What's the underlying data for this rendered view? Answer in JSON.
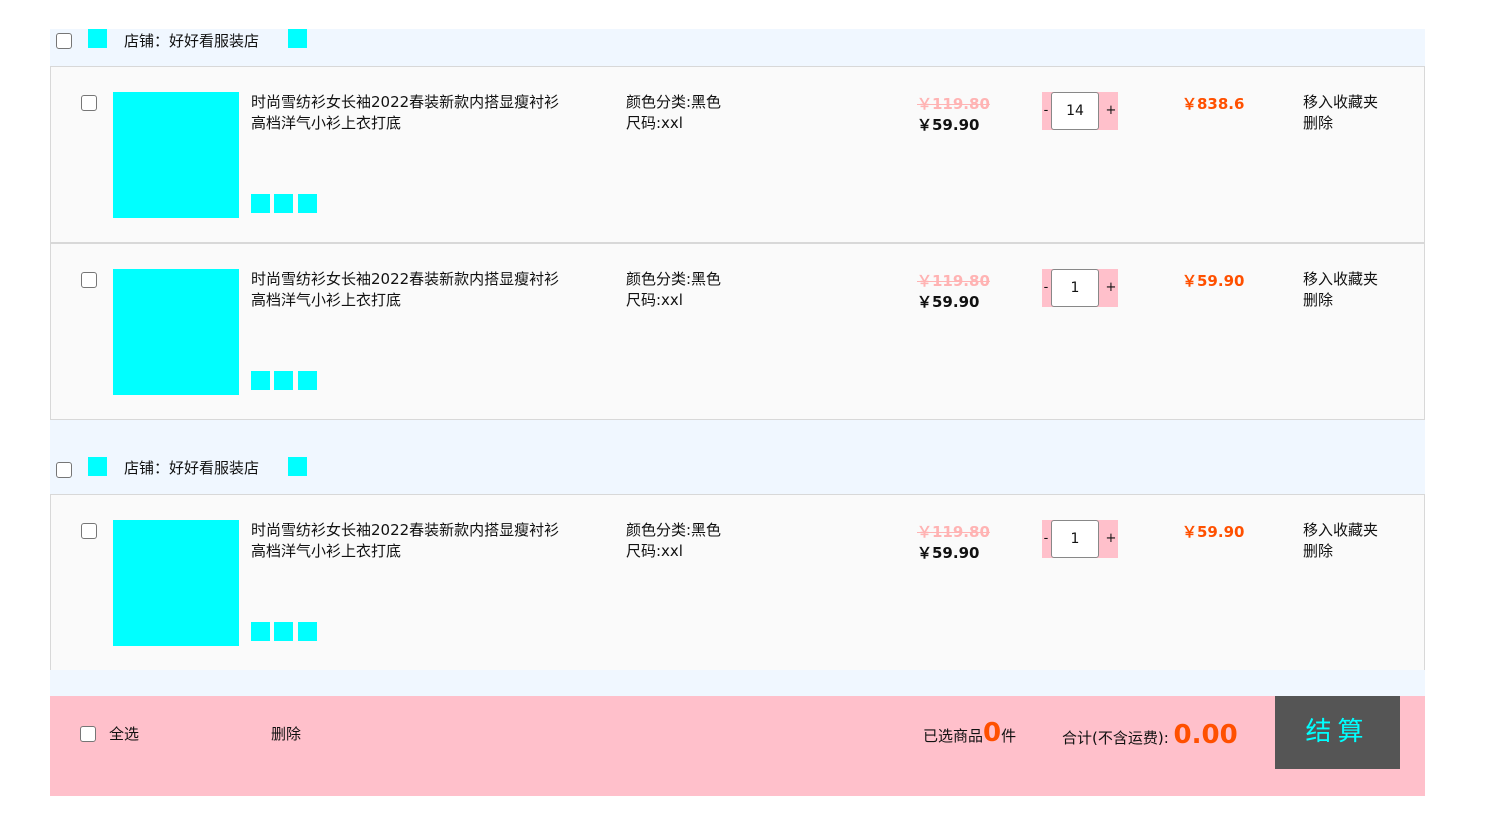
{
  "shops": [
    {
      "name": "店铺：好好看服装店",
      "items": [
        {
          "title": "时尚雪纺衫女长袖2022春装新款内搭显瘦衬衫高档洋气小衫上衣打底",
          "color": "颜色分类:黑色",
          "size": "尺码:xxl",
          "old_price": "￥119.80",
          "price": "￥59.90",
          "qty": "14",
          "subtotal": "￥838.6",
          "op_fav": "移入收藏夹",
          "op_del": "删除"
        },
        {
          "title": "时尚雪纺衫女长袖2022春装新款内搭显瘦衬衫高档洋气小衫上衣打底",
          "color": "颜色分类:黑色",
          "size": "尺码:xxl",
          "old_price": "￥119.80",
          "price": "￥59.90",
          "qty": "1",
          "subtotal": "￥59.90",
          "op_fav": "移入收藏夹",
          "op_del": "删除"
        }
      ]
    },
    {
      "name": "店铺：好好看服装店",
      "items": [
        {
          "title": "时尚雪纺衫女长袖2022春装新款内搭显瘦衬衫高档洋气小衫上衣打底",
          "color": "颜色分类:黑色",
          "size": "尺码:xxl",
          "old_price": "￥119.80",
          "price": "￥59.90",
          "qty": "1",
          "subtotal": "￥59.90",
          "op_fav": "移入收藏夹",
          "op_del": "删除"
        }
      ]
    }
  ],
  "qty_controls": {
    "minus": "-",
    "plus": "+"
  },
  "footer": {
    "select_all": "全选",
    "delete": "删除",
    "selected_prefix": "已选商品",
    "selected_count": "0",
    "selected_suffix": "件",
    "total_label": "合计(不含运费): ",
    "total_value": "0.00",
    "checkout": "结算"
  },
  "colors": {
    "accent": "#00ffff",
    "price": "#ff5000",
    "footer_bg": "#ffc0cb",
    "checkout_bg": "#555555",
    "shop_bg": "#f0f7ff"
  }
}
